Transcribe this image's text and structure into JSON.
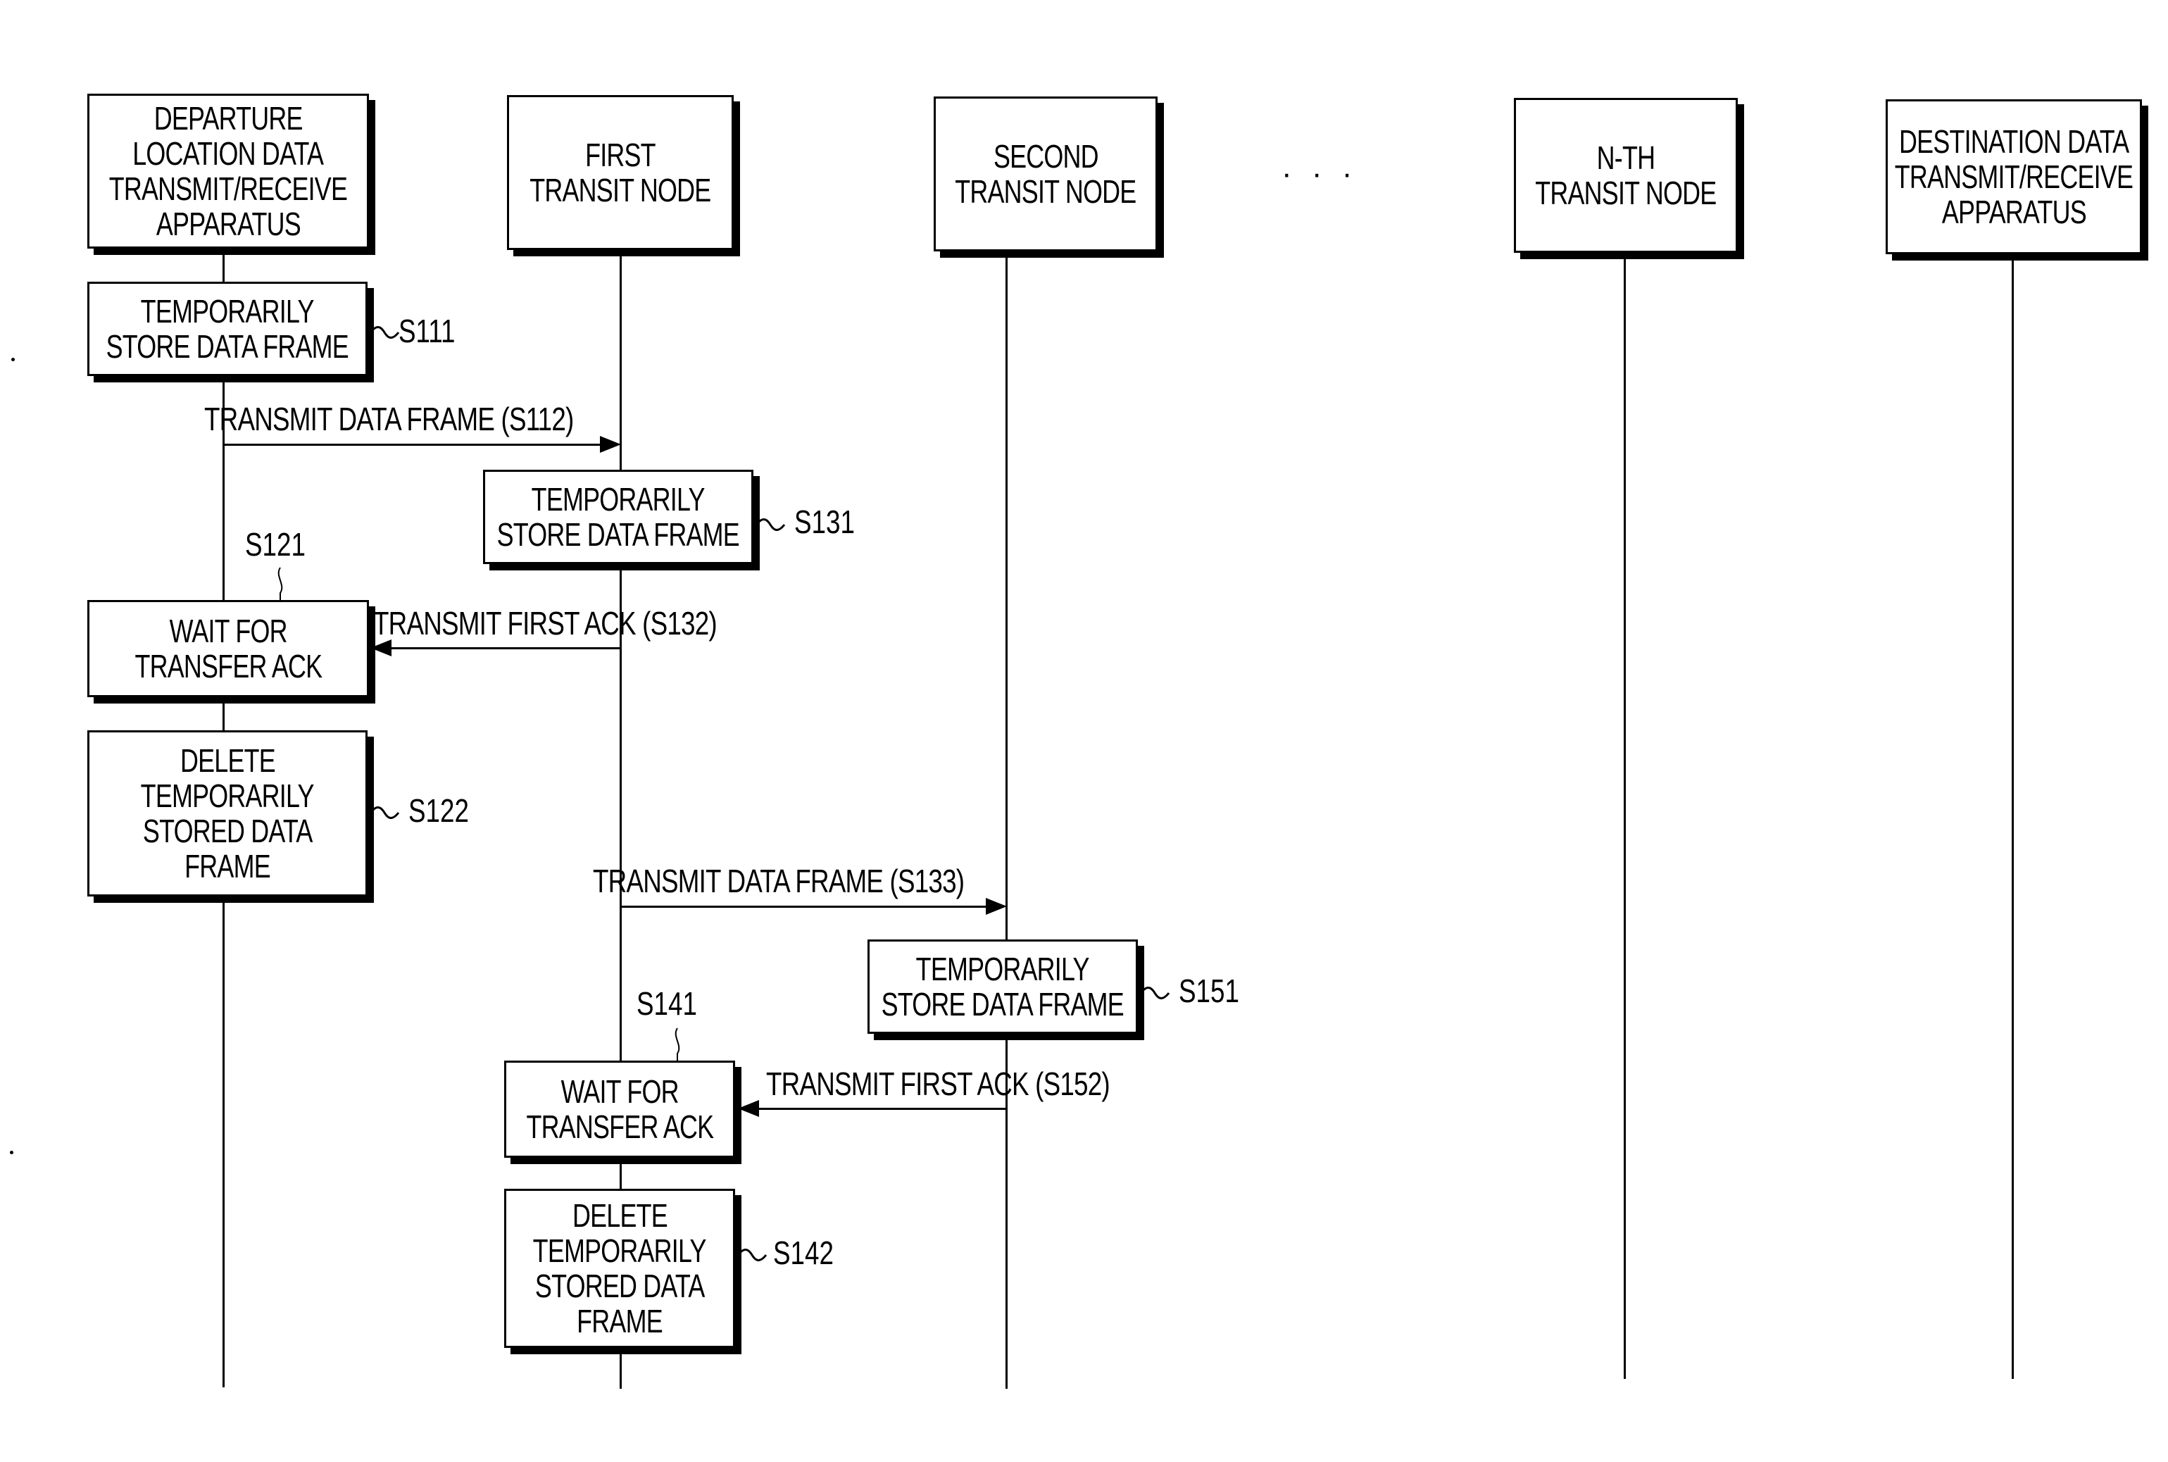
{
  "participants": [
    {
      "id": "departure",
      "lines": [
        "DEPARTURE",
        "LOCATION DATA",
        "TRANSMIT/RECEIVE",
        "APPARATUS"
      ]
    },
    {
      "id": "first",
      "lines": [
        "FIRST",
        "TRANSIT NODE"
      ]
    },
    {
      "id": "second",
      "lines": [
        "SECOND",
        "TRANSIT NODE"
      ]
    },
    {
      "id": "nth",
      "lines": [
        "N-TH",
        "TRANSIT NODE"
      ]
    },
    {
      "id": "destination",
      "lines": [
        "DESTINATION DATA",
        "TRANSMIT/RECEIVE",
        "APPARATUS"
      ]
    }
  ],
  "ellipsis": "· · ·",
  "activities": [
    {
      "step": "S111",
      "lines": [
        "TEMPORARILY",
        "STORE DATA FRAME"
      ]
    },
    {
      "step": "S131",
      "lines": [
        "TEMPORARILY",
        "STORE DATA FRAME"
      ]
    },
    {
      "step": "S121",
      "lines": [
        "WAIT FOR",
        "TRANSFER ACK"
      ]
    },
    {
      "step": "S122",
      "lines": [
        "DELETE",
        "TEMPORARILY",
        "STORED DATA",
        "FRAME"
      ]
    },
    {
      "step": "S151",
      "lines": [
        "TEMPORARILY",
        "STORE DATA FRAME"
      ]
    },
    {
      "step": "S141",
      "lines": [
        "WAIT FOR",
        "TRANSFER ACK"
      ]
    },
    {
      "step": "S142",
      "lines": [
        "DELETE",
        "TEMPORARILY",
        "STORED DATA",
        "FRAME"
      ]
    }
  ],
  "messages": [
    {
      "label": "TRANSMIT DATA FRAME (S112)",
      "from": "departure",
      "to": "first"
    },
    {
      "label": "TRANSMIT FIRST ACK (S132)",
      "from": "first",
      "to": "departure"
    },
    {
      "label": "TRANSMIT DATA FRAME (S133)",
      "from": "first",
      "to": "second"
    },
    {
      "label": "TRANSMIT FIRST ACK (S152)",
      "from": "second",
      "to": "first"
    }
  ]
}
